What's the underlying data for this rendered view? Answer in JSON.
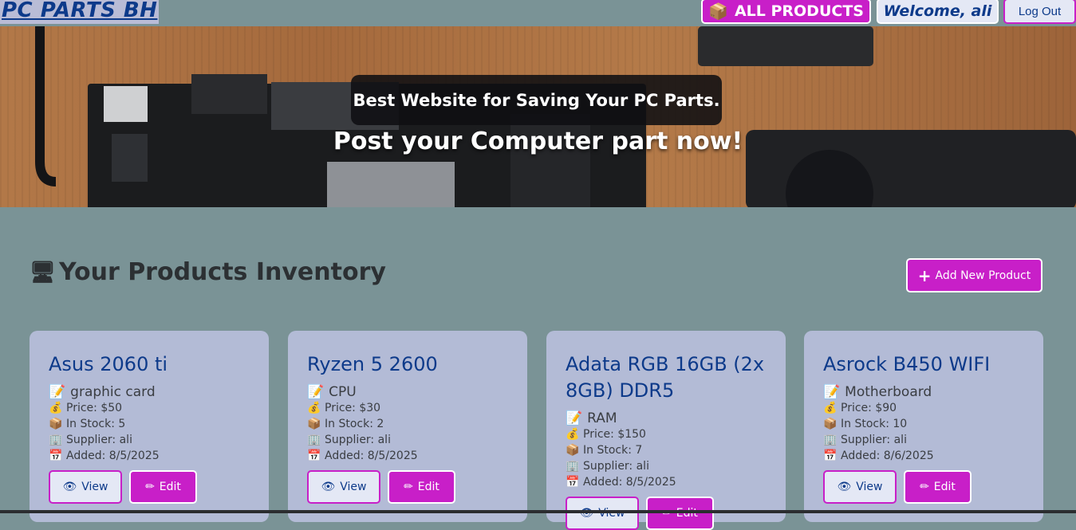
{
  "nav": {
    "brand": "PC PARTS BH",
    "all_products_icon": "📦",
    "all_products": "ALL PRODUCTS",
    "welcome": "Welcome, ali",
    "logout": "Log Out"
  },
  "hero": {
    "tagline": "Best Website for Saving Your PC Parts.",
    "subtitle": "Post your Computer part now!"
  },
  "inventory": {
    "icon": "🖥",
    "title": "Your Products Inventory",
    "add_icon": "+",
    "add_button": "Add New Product"
  },
  "icons": {
    "category": "📝",
    "price": "💰",
    "stock": "📦",
    "supplier": "🏢",
    "added": "📅",
    "view": "👁",
    "edit": "✏"
  },
  "products": [
    {
      "name": "Asus 2060 ti",
      "category": "graphic card",
      "price": "Price: $50",
      "stock": "In Stock: 5",
      "supplier": "Supplier: ali",
      "added": "Added: 8/5/2025",
      "view": "View",
      "edit": "Edit"
    },
    {
      "name": "Ryzen 5 2600",
      "category": "CPU",
      "price": "Price: $30",
      "stock": "In Stock: 2",
      "supplier": "Supplier: ali",
      "added": "Added: 8/5/2025",
      "view": "View",
      "edit": "Edit"
    },
    {
      "name": "Adata RGB 16GB (2x 8GB) DDR5",
      "category": "RAM",
      "price": "Price: $150",
      "stock": "In Stock: 7",
      "supplier": "Supplier: ali",
      "added": "Added: 8/5/2025",
      "view": "View",
      "edit": "Edit"
    },
    {
      "name": "Asrock B450 WIFI",
      "category": "Motherboard",
      "price": "Price: $90",
      "stock": "In Stock: 10",
      "supplier": "Supplier: ali",
      "added": "Added: 8/6/2025",
      "view": "View",
      "edit": "Edit"
    }
  ]
}
